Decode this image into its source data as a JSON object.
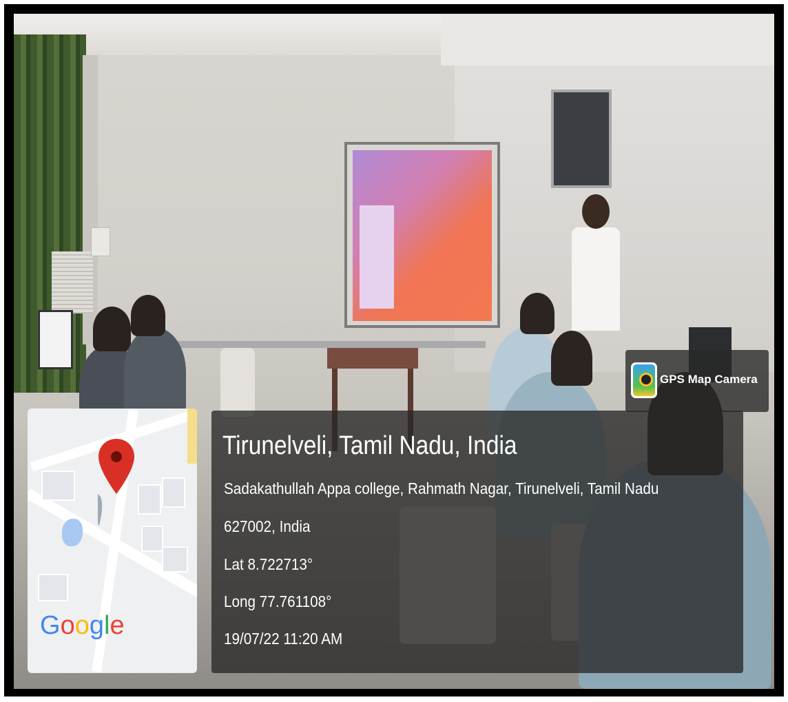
{
  "overlay": {
    "badge_label": "GPS Map Camera",
    "location_title": "Tirunelveli, Tamil Nadu, India",
    "address_line1": "Sadakathullah Appa college, Rahmath Nagar, Tirunelveli, Tamil Nadu",
    "address_line2": "627002, India",
    "latitude": "Lat 8.722713°",
    "longitude": "Long 77.761108°",
    "timestamp": "19/07/22 11:20 AM"
  },
  "map": {
    "logo_letters": [
      "G",
      "o",
      "o",
      "g",
      "l",
      "e"
    ],
    "pin_color": "#d93025"
  },
  "icons": {
    "badge": "gps-map-camera-app-icon",
    "pin": "map-pin-icon"
  }
}
